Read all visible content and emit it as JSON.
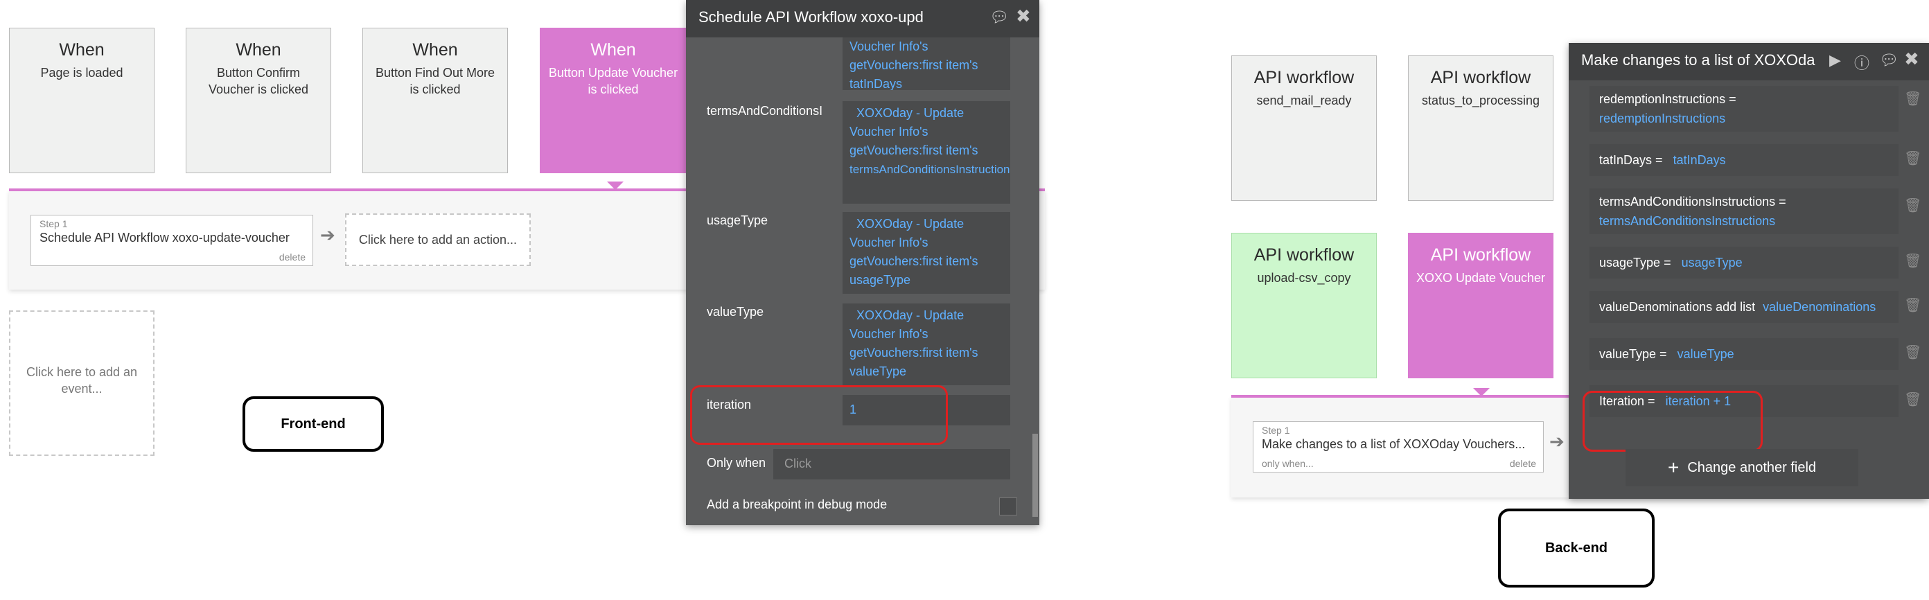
{
  "frontend": {
    "events": [
      {
        "title": "When",
        "sub": "Page is loaded"
      },
      {
        "title": "When",
        "sub": "Button Confirm Voucher is clicked"
      },
      {
        "title": "When",
        "sub": "Button Find Out More is clicked"
      },
      {
        "title": "When",
        "sub": "Button Update Voucher is clicked"
      }
    ],
    "step": {
      "label": "Step 1",
      "text": "Schedule API Workflow xoxo-update-voucher",
      "delete": "delete"
    },
    "add_action": "Click here to add an action...",
    "add_event": "Click here to add an event...",
    "tag": "Front-end"
  },
  "schedule_panel": {
    "title": "Schedule API Workflow xoxo-upd",
    "top_value": [
      "Voucher Info's",
      "getVouchers:first item's",
      "tatInDays"
    ],
    "fields": [
      {
        "name": "termsAndConditionsI",
        "value": [
          "XOXOday - Update",
          "Voucher Info's",
          "getVouchers:first item's",
          "termsAndConditionsInstructions"
        ]
      },
      {
        "name": "usageType",
        "value": [
          "XOXOday - Update",
          "Voucher Info's",
          "getVouchers:first item's",
          "usageType"
        ]
      },
      {
        "name": "valueType",
        "value": [
          "XOXOday - Update",
          "Voucher Info's",
          "getVouchers:first item's",
          "valueType"
        ]
      }
    ],
    "iteration": {
      "name": "iteration",
      "value": "1"
    },
    "only_when": {
      "label": "Only when",
      "placeholder": "Click"
    },
    "breakpoint": "Add a breakpoint in debug mode"
  },
  "backend": {
    "workflows": [
      {
        "title": "API workflow",
        "sub": "send_mail_ready"
      },
      {
        "title": "API workflow",
        "sub": "status_to_processing"
      },
      {
        "title": "API workflow",
        "sub": "upload-csv_copy"
      },
      {
        "title": "API workflow",
        "sub": "XOXO Update Voucher"
      }
    ],
    "step": {
      "label": "Step 1",
      "text": "Make changes to a list of XOXOday Vouchers...",
      "only_when": "only when...",
      "delete": "delete"
    },
    "tag": "Back-end"
  },
  "changes_panel": {
    "title": "Make changes to a list of XOXOda",
    "rows": [
      {
        "key": "redemptionInstructions  =",
        "val": "redemptionInstructions"
      },
      {
        "key": "tatInDays  =",
        "val": "tatInDays"
      },
      {
        "key": "termsAndConditionsInstructions  =",
        "val": "termsAndConditionsInstructions"
      },
      {
        "key": "usageType  =",
        "val": "usageType"
      },
      {
        "key": "valueDenominations add list",
        "val": "valueDenominations"
      },
      {
        "key": "valueType  =",
        "val": "valueType"
      },
      {
        "key": "Iteration  =",
        "val": "iteration + 1"
      }
    ],
    "change_button": "Change another field"
  },
  "colors": {
    "accent_pink": "#d97ad0",
    "highlight_red": "#e02020",
    "link_blue": "#5fb0ff",
    "panel_dark": "#5a5b5c"
  }
}
